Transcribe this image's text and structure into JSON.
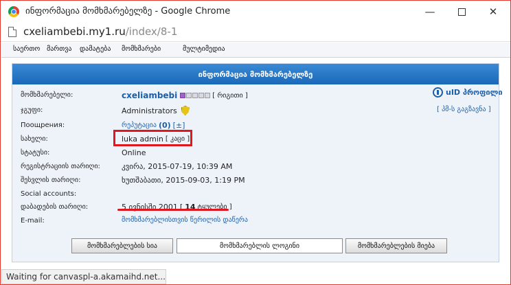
{
  "window": {
    "title": "ინფორმაცია მომხმარებელზე - Google Chrome",
    "minimize_glyph": "—",
    "close_glyph": "✕"
  },
  "address": {
    "host": "cxeliambebi.my1.ru",
    "path": "/index/8-1"
  },
  "nav": {
    "items": [
      "საერთო",
      "მართვა",
      "დამატება",
      "მომხმარები",
      "მულტიმედია"
    ]
  },
  "panel": {
    "title": "ინფორმაცია მომხმარებელზე"
  },
  "profile": {
    "rows": [
      {
        "label": "მომხმარებელი:"
      },
      {
        "label": "ჯგუფი:"
      },
      {
        "label": "Поощрения:"
      },
      {
        "label": "სახელი:"
      },
      {
        "label": "სტატუსი:"
      },
      {
        "label": "რეგისტრაციის თარიღი:"
      },
      {
        "label": "შესვლის თარიღი:"
      },
      {
        "label": "Social accounts:"
      },
      {
        "label": "დაბადების თარიღი:"
      },
      {
        "label": "E-mail:"
      }
    ],
    "username": "cxeliambebi",
    "rank": "[ რიგითი ]",
    "group": "Administrators",
    "reputation_label": "რეპუტაცია",
    "reputation_value": "(0)",
    "reputation_toggle": "[±]",
    "name_value": "luka admin",
    "gender": "[ კაცი ]",
    "status": "Online",
    "registered": "კვირა, 2015-07-19, 10:39 AM",
    "last_login": "ხუთშაბათი, 2015-09-03, 1:19 PM",
    "birth_date": "5 ივნისში 2001",
    "age_open": "[",
    "age_number": "14",
    "age_suffix": "ტყულები ]",
    "email_link": "მომხმარებლისთვის წერილის დაწერა",
    "uid_label": "uID პროფილი",
    "pm_link": "[ პმ-ს გაგზავნა ]"
  },
  "buttons": {
    "list": "მომხმარებლების სია",
    "search": "მომხმარებლის ლოგინი",
    "main": "მომხმარებლების მიება"
  },
  "status_bar": "Waiting for canvaspl-a.akamaihd.net...",
  "colors": {
    "header_blue": "#1a68b8",
    "link_blue": "#1b5fa8",
    "highlight_red": "#e0171f"
  }
}
